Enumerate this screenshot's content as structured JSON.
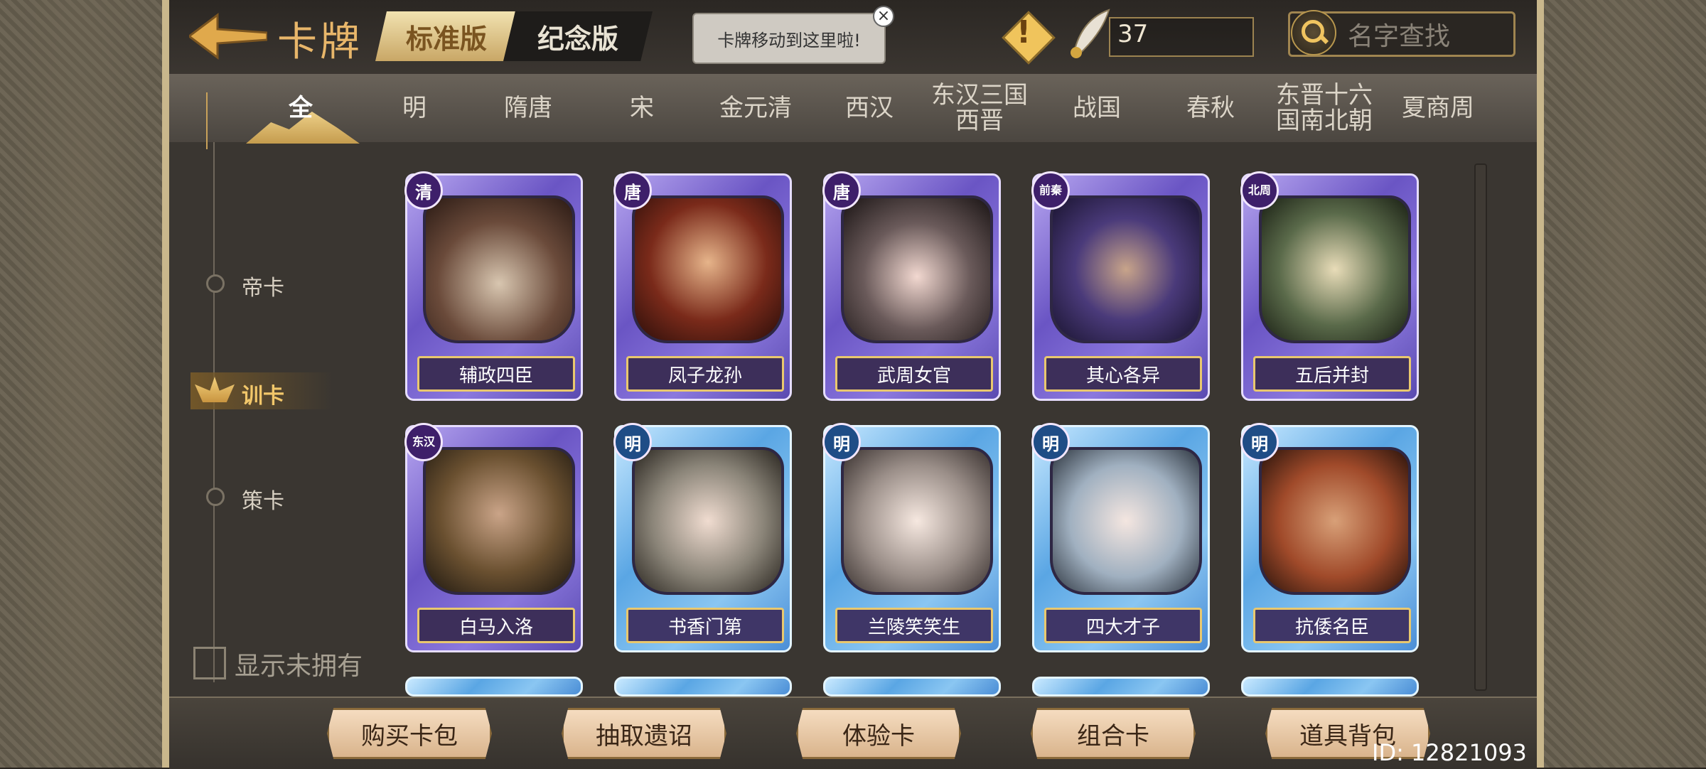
{
  "header": {
    "title": "卡牌",
    "version_tabs": [
      "标准版",
      "纪念版"
    ],
    "tooltip": "卡牌移动到这里啦!",
    "currency": "37",
    "search_placeholder": "名字查找"
  },
  "eras": [
    "全",
    "明",
    "隋唐",
    "宋",
    "金元清",
    "西汉",
    "东汉三国西晋",
    "战国",
    "春秋",
    "东晋十六国南北朝",
    "夏商周"
  ],
  "categories": [
    "帝卡",
    "训卡",
    "策卡"
  ],
  "show_unowned": "显示未拥有",
  "cards": [
    {
      "badge": "清",
      "name": "辅政四臣",
      "color": "purple"
    },
    {
      "badge": "唐",
      "name": "凤子龙孙",
      "color": "purple"
    },
    {
      "badge": "唐",
      "name": "武周女官",
      "color": "purple"
    },
    {
      "badge": "前秦",
      "name": "其心各异",
      "color": "purple"
    },
    {
      "badge": "北周",
      "name": "五后并封",
      "color": "purple"
    },
    {
      "badge": "东汉",
      "name": "白马入洛",
      "color": "purple"
    },
    {
      "badge": "明",
      "name": "书香门第",
      "color": "blue"
    },
    {
      "badge": "明",
      "name": "兰陵笑笑生",
      "color": "blue"
    },
    {
      "badge": "明",
      "name": "四大才子",
      "color": "blue"
    },
    {
      "badge": "明",
      "name": "抗倭名臣",
      "color": "blue"
    }
  ],
  "footer": {
    "buttons": [
      "购买卡包",
      "抽取遗诏",
      "体验卡",
      "组合卡",
      "道具背包"
    ],
    "uid": "ID: 12821093"
  }
}
